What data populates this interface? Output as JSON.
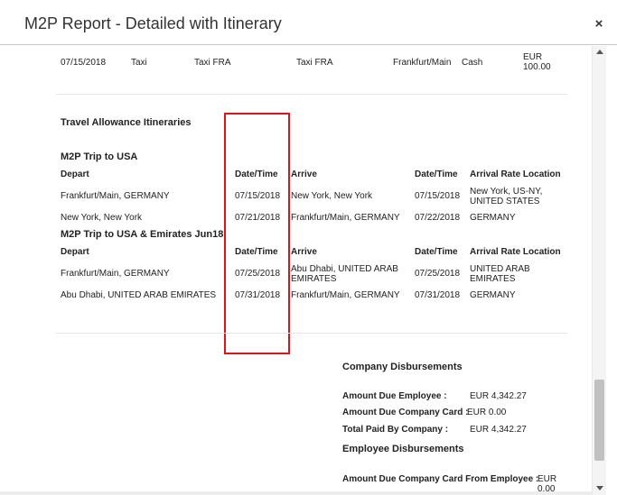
{
  "dialog": {
    "title": "M2P Report - Detailed with Itinerary",
    "close_label": "×"
  },
  "expense_row": {
    "date": "07/15/2018",
    "type": "Taxi",
    "vendor": "Taxi FRA",
    "description": "Taxi FRA",
    "location": "Frankfurt/Main",
    "payment": "Cash",
    "currency": "EUR",
    "amount": "100.00"
  },
  "section_title": "Travel Allowance Itineraries",
  "trips": [
    {
      "name": "M2P Trip to USA",
      "headers": {
        "depart": "Depart",
        "depart_dt": "Date/Time",
        "arrive": "Arrive",
        "arrive_dt": "Date/Time",
        "rate_location": "Arrival Rate Location"
      },
      "rows": [
        {
          "depart": "Frankfurt/Main, GERMANY",
          "depart_dt": "07/15/2018",
          "arrive": "New York, New York",
          "arrive_dt": "07/15/2018",
          "rate_line1": "New York, US-NY,",
          "rate_line2": "UNITED STATES"
        },
        {
          "depart": "New York, New York",
          "depart_dt": "07/21/2018",
          "arrive": "Frankfurt/Main, GERMANY",
          "arrive_dt": "07/22/2018",
          "rate_line1": "GERMANY",
          "rate_line2": ""
        }
      ]
    },
    {
      "name": "M2P Trip to USA & Emirates Jun18",
      "headers": {
        "depart": "Depart",
        "depart_dt": "Date/Time",
        "arrive": "Arrive",
        "arrive_dt": "Date/Time",
        "rate_location": "Arrival Rate Location"
      },
      "rows": [
        {
          "depart": "Frankfurt/Main, GERMANY",
          "depart_dt": "07/25/2018",
          "arrive_line1": "Abu Dhabi, UNITED ARAB",
          "arrive_line2": "EMIRATES",
          "arrive_dt": "07/25/2018",
          "rate_line1": "UNITED ARAB",
          "rate_line2": "EMIRATES"
        },
        {
          "depart": "Abu Dhabi, UNITED ARAB EMIRATES",
          "depart_dt": "07/31/2018",
          "arrive": "Frankfurt/Main, GERMANY",
          "arrive_dt": "07/31/2018",
          "rate_line1": "GERMANY",
          "rate_line2": ""
        }
      ]
    }
  ],
  "company_disbursements": {
    "title": "Company Disbursements",
    "due_employee_label": "Amount Due Employee :",
    "due_employee_value": "EUR 4,342.27",
    "due_card_label": "Amount Due Company Card :",
    "due_card_value": "EUR 0.00",
    "total_paid_label": "Total Paid By Company :",
    "total_paid_value": "EUR 4,342.27"
  },
  "employee_disbursements": {
    "title": "Employee Disbursements",
    "due_card_from_employee_label": "Amount Due Company Card From Employee :",
    "due_card_from_employee_currency": "EUR",
    "due_card_from_employee_amount": "0.00"
  },
  "colors": {
    "highlight": "#e0131c",
    "divider": "#e6e6e6"
  }
}
